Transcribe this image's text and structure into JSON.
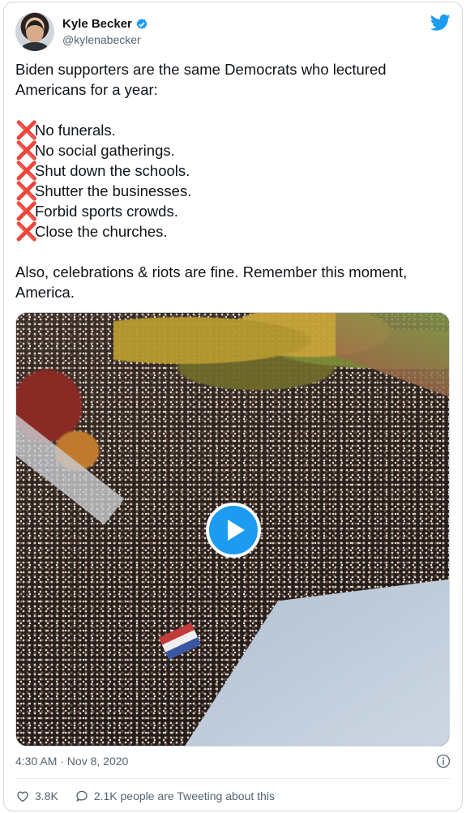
{
  "author": {
    "display_name": "Kyle Becker",
    "handle": "@kylenabecker"
  },
  "tweet": {
    "intro": "Biden supporters are the same Democrats who lectured Americans for a year:",
    "list_marker": "❌",
    "items": [
      "No funerals.",
      "No social gatherings.",
      "Shut down the schools.",
      "Shutter the businesses.",
      "Forbid sports crowds.",
      "Close the churches."
    ],
    "closing": "Also, celebrations & riots are fine. Remember this moment, America."
  },
  "meta": {
    "timestamp": "4:30 AM · Nov 8, 2020"
  },
  "footer": {
    "likes": "3.8K",
    "conversation": "2.1K people are Tweeting about this"
  },
  "colors": {
    "accent": "#1d9bf0",
    "x_mark": "#e0245e",
    "secondary_text": "#536471"
  },
  "icons": {
    "verified": "verified-badge-icon",
    "bird": "twitter-bird-icon",
    "play": "play-icon",
    "info": "info-icon",
    "like": "heart-icon",
    "reply": "speech-bubble-icon"
  }
}
